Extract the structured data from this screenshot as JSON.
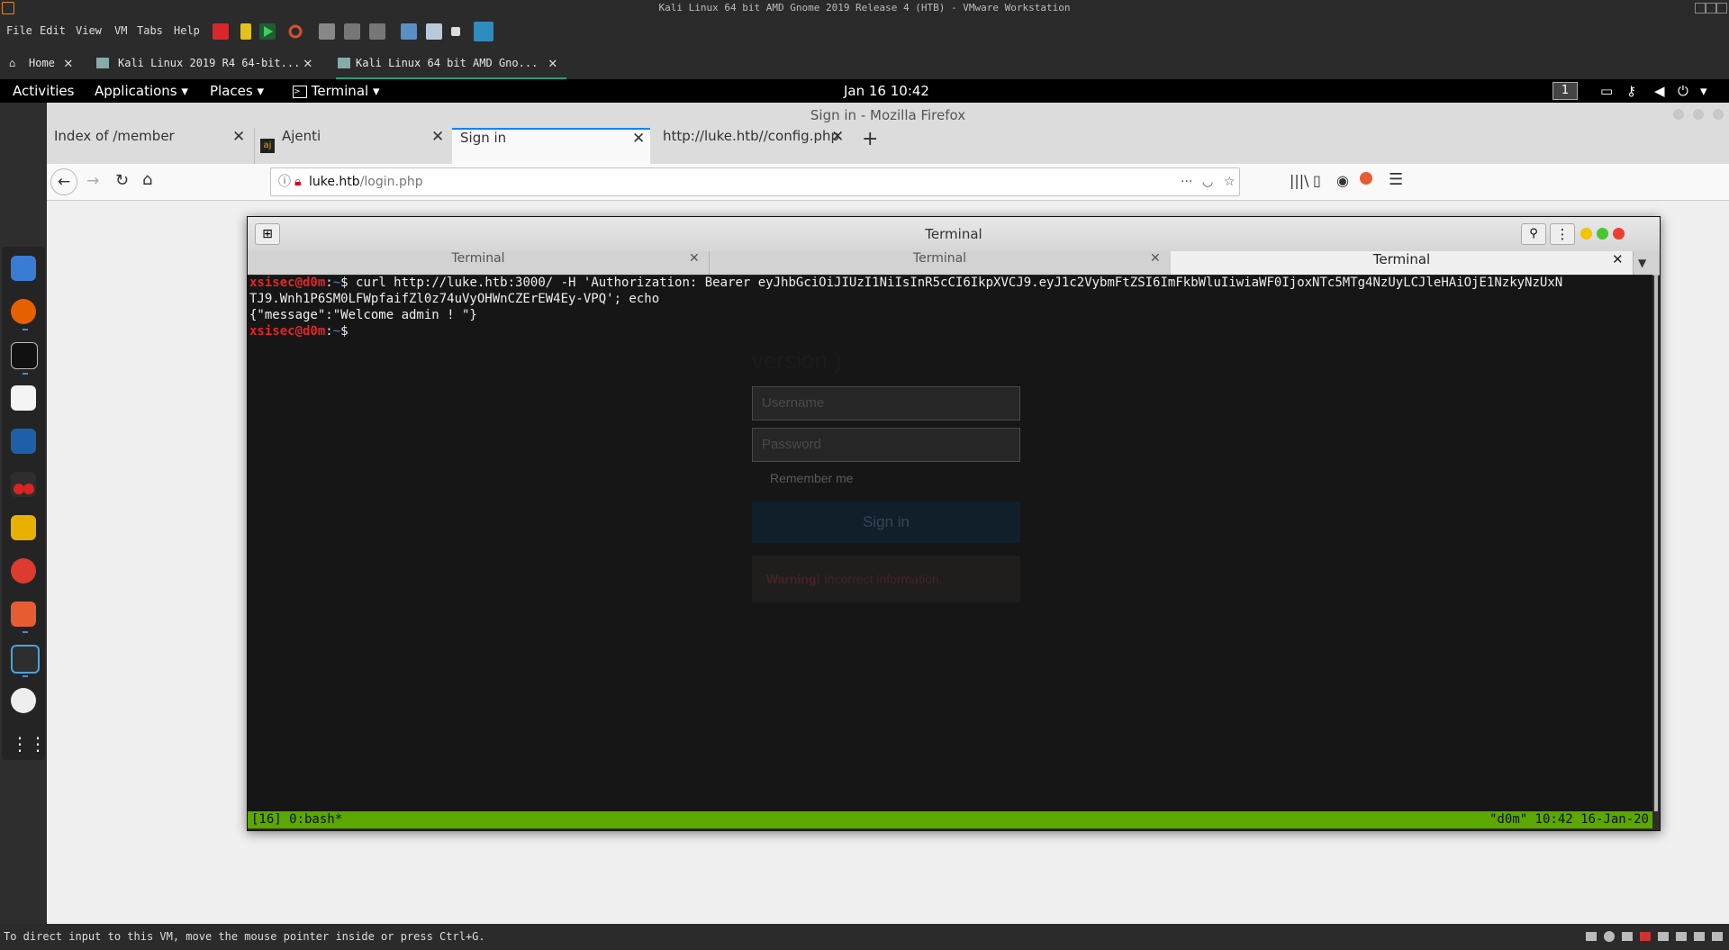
{
  "vmware": {
    "title": "Kali Linux 64 bit AMD Gnome 2019 Release 4 (HTB) - VMware Workstation",
    "menu": [
      "File",
      "Edit",
      "View",
      "VM",
      "Tabs",
      "Help"
    ],
    "tabs": [
      {
        "label": "Home"
      },
      {
        "label": "Kali Linux 2019 R4 64-bit..."
      },
      {
        "label": "Kali Linux 64 bit AMD Gno..."
      }
    ],
    "status_text": "To direct input to this VM, move the mouse pointer inside or press Ctrl+G."
  },
  "gnome": {
    "activities": "Activities",
    "applications": "Applications",
    "places": "Places",
    "terminal": "Terminal",
    "clock": "Jan 16  10:42",
    "workspace": "1"
  },
  "firefox": {
    "window_title": "Sign in - Mozilla Firefox",
    "tabs": [
      {
        "label": "Index of /member"
      },
      {
        "label": "Ajenti"
      },
      {
        "label": "Sign in"
      },
      {
        "label": "http://luke.htb//config.php"
      }
    ],
    "url_host": "luke.htb",
    "url_path": "/login.php",
    "page": {
      "heading_fragment": "version )",
      "username_placeholder": "Username",
      "password_placeholder": "Password",
      "remember": "Remember me",
      "signin": "Sign in",
      "warning_bold": "Warning!",
      "warning_text": " Incorrect information."
    }
  },
  "terminal": {
    "title": "Terminal",
    "tabs": [
      {
        "label": "Terminal"
      },
      {
        "label": "Terminal"
      },
      {
        "label": "Terminal"
      }
    ],
    "prompt_user": "xsisec@d0m",
    "prompt_sep": ":",
    "prompt_path": "~",
    "prompt_end": "$ ",
    "command_line1": "curl http://luke.htb:3000/ -H 'Authorization: Bearer eyJhbGciOiJIUzI1NiIsInR5cCI6IkpXVCJ9.eyJ1c2VybmFtZSI6ImFkbWluIiwiaWF0IjoxNTc5MTg4NzUyLCJleHAiOjE1NzkyNzUxN",
    "command_line2": "TJ9.Wnh1P6SM0LFWpfaifZl0z74uVyOHWnCZErEW4Ey-VPQ'; echo",
    "output": "{\"message\":\"Welcome admin ! \"}",
    "status_left": "[16] 0:bash*",
    "status_right": "\"d0m\" 10:42 16-Jan-20"
  }
}
